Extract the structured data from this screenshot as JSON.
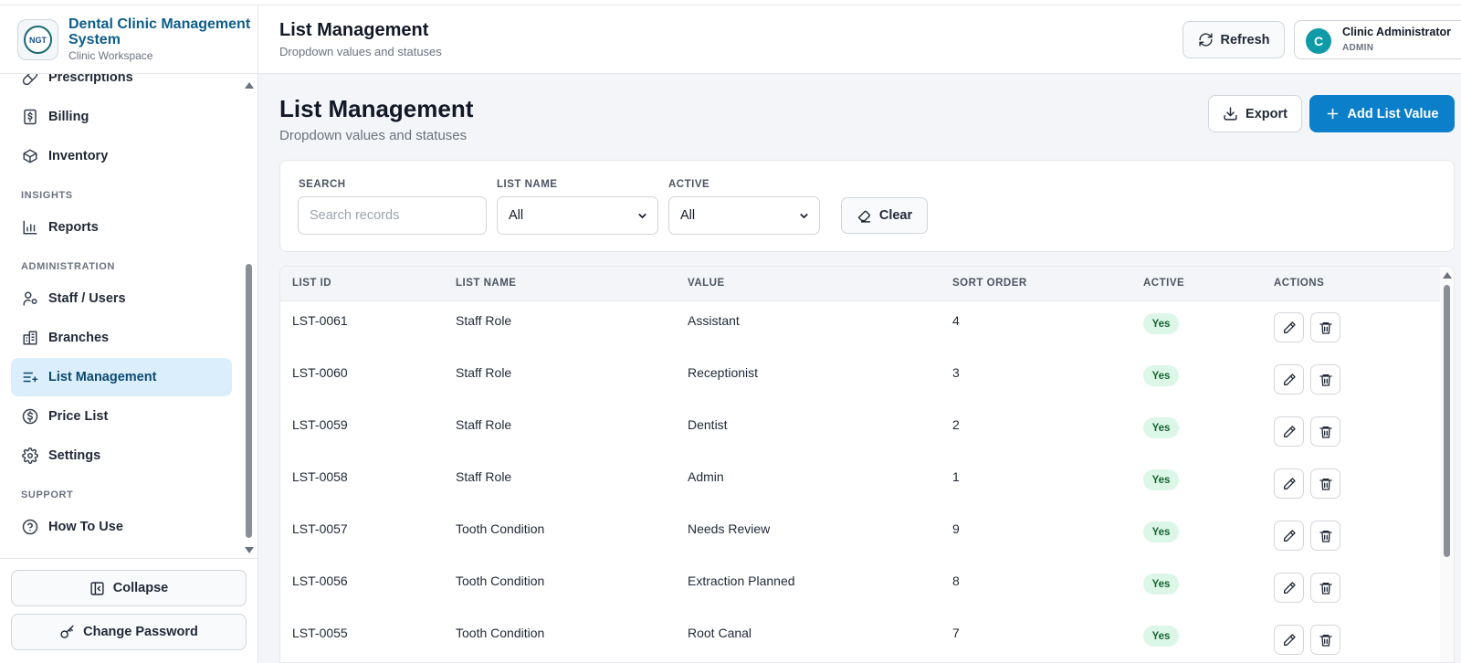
{
  "brand": {
    "logo_text": "NGT",
    "title": "Dental Clinic Management System",
    "subtitle": "Clinic Workspace"
  },
  "sidebar": {
    "items": [
      {
        "label": "Prescriptions",
        "icon": "pill-icon"
      },
      {
        "label": "Billing",
        "icon": "receipt-icon"
      },
      {
        "label": "Inventory",
        "icon": "box-icon"
      },
      {
        "label": "Reports",
        "icon": "bar-chart-icon"
      },
      {
        "label": "Staff / Users",
        "icon": "users-icon"
      },
      {
        "label": "Branches",
        "icon": "building-icon"
      },
      {
        "label": "List Management",
        "icon": "list-plus-icon",
        "active": true
      },
      {
        "label": "Price List",
        "icon": "dollar-circle-icon"
      },
      {
        "label": "Settings",
        "icon": "gear-icon"
      },
      {
        "label": "How To Use",
        "icon": "help-circle-icon"
      }
    ],
    "sections": {
      "insights": "INSIGHTS",
      "administration": "ADMINISTRATION",
      "support": "SUPPORT"
    },
    "collapse_label": "Collapse",
    "change_password_label": "Change Password"
  },
  "header": {
    "title": "List Management",
    "subtitle": "Dropdown values and statuses",
    "refresh_label": "Refresh",
    "user_initial": "C",
    "user_name": "Clinic Administrator",
    "user_role": "ADMIN"
  },
  "page": {
    "title": "List Management",
    "subtitle": "Dropdown values and statuses",
    "export_label": "Export",
    "add_label": "Add List Value"
  },
  "filters": {
    "search_label": "SEARCH",
    "search_placeholder": "Search records",
    "list_name_label": "LIST NAME",
    "list_name_value": "All",
    "active_label": "ACTIVE",
    "active_value": "All",
    "clear_label": "Clear"
  },
  "table": {
    "columns": [
      "LIST ID",
      "LIST NAME",
      "VALUE",
      "SORT ORDER",
      "ACTIVE",
      "ACTIONS"
    ],
    "rows": [
      {
        "id": "LST-0061",
        "list_name": "Staff Role",
        "value": "Assistant",
        "sort": "4",
        "active": "Yes"
      },
      {
        "id": "LST-0060",
        "list_name": "Staff Role",
        "value": "Receptionist",
        "sort": "3",
        "active": "Yes"
      },
      {
        "id": "LST-0059",
        "list_name": "Staff Role",
        "value": "Dentist",
        "sort": "2",
        "active": "Yes"
      },
      {
        "id": "LST-0058",
        "list_name": "Staff Role",
        "value": "Admin",
        "sort": "1",
        "active": "Yes"
      },
      {
        "id": "LST-0057",
        "list_name": "Tooth Condition",
        "value": "Needs Review",
        "sort": "9",
        "active": "Yes"
      },
      {
        "id": "LST-0056",
        "list_name": "Tooth Condition",
        "value": "Extraction Planned",
        "sort": "8",
        "active": "Yes"
      },
      {
        "id": "LST-0055",
        "list_name": "Tooth Condition",
        "value": "Root Canal",
        "sort": "7",
        "active": "Yes"
      }
    ]
  },
  "colors": {
    "accent": "#0b7fc9",
    "brand": "#0c5e8a",
    "active_nav": "#dbeefb",
    "badge_bg": "#dcf7e7",
    "badge_text": "#166534"
  }
}
